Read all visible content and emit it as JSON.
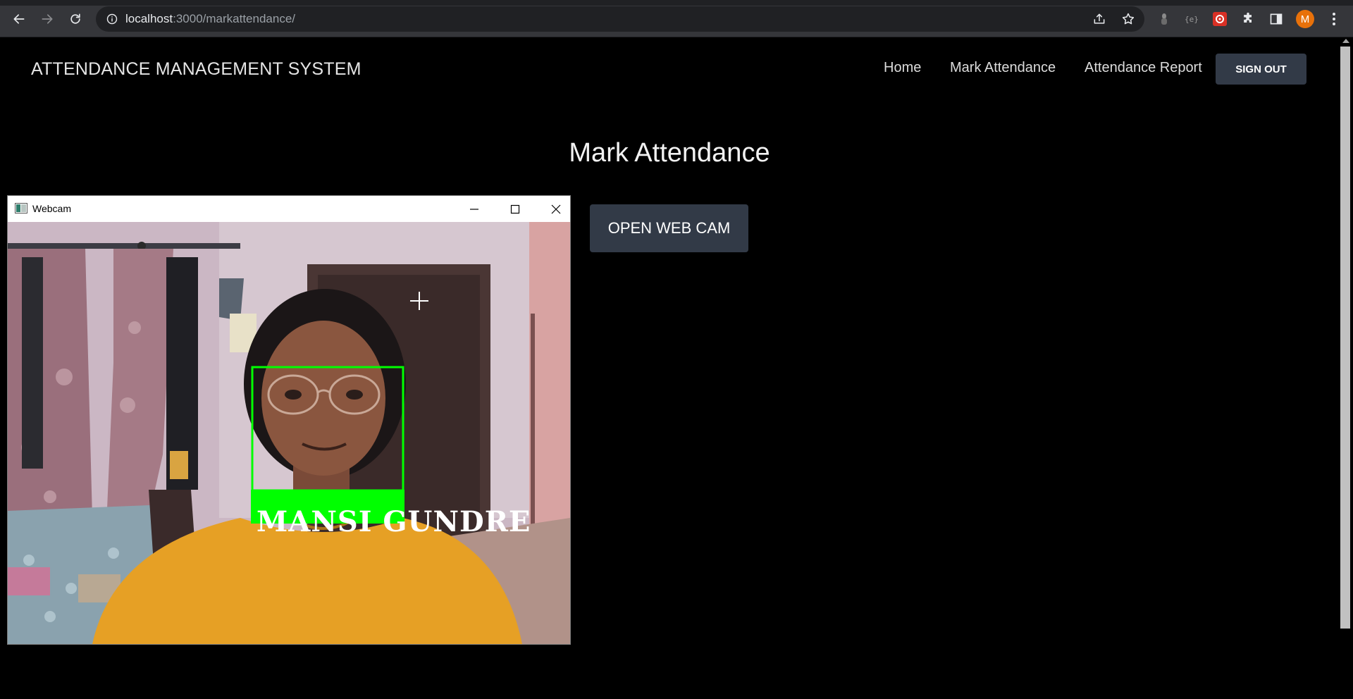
{
  "browser": {
    "url_host": "localhost",
    "url_path": ":3000/markattendance/",
    "avatar_letter": "M"
  },
  "navbar": {
    "brand": "ATTENDANCE MANAGEMENT SYSTEM",
    "links": [
      {
        "label": "Home"
      },
      {
        "label": "Mark Attendance"
      },
      {
        "label": "Attendance Report"
      }
    ],
    "signout_label": "SIGN OUT"
  },
  "main": {
    "title": "Mark Attendance",
    "open_cam_label": "OPEN WEB CAM"
  },
  "webcam_window": {
    "title": "Webcam",
    "detected_name": "MANSI GUNDRE",
    "box_color": "#00ff00"
  },
  "colors": {
    "page_bg": "#000000",
    "button_bg": "#323a47",
    "chrome_bg": "#35363a",
    "avatar_bg": "#e8710a"
  }
}
